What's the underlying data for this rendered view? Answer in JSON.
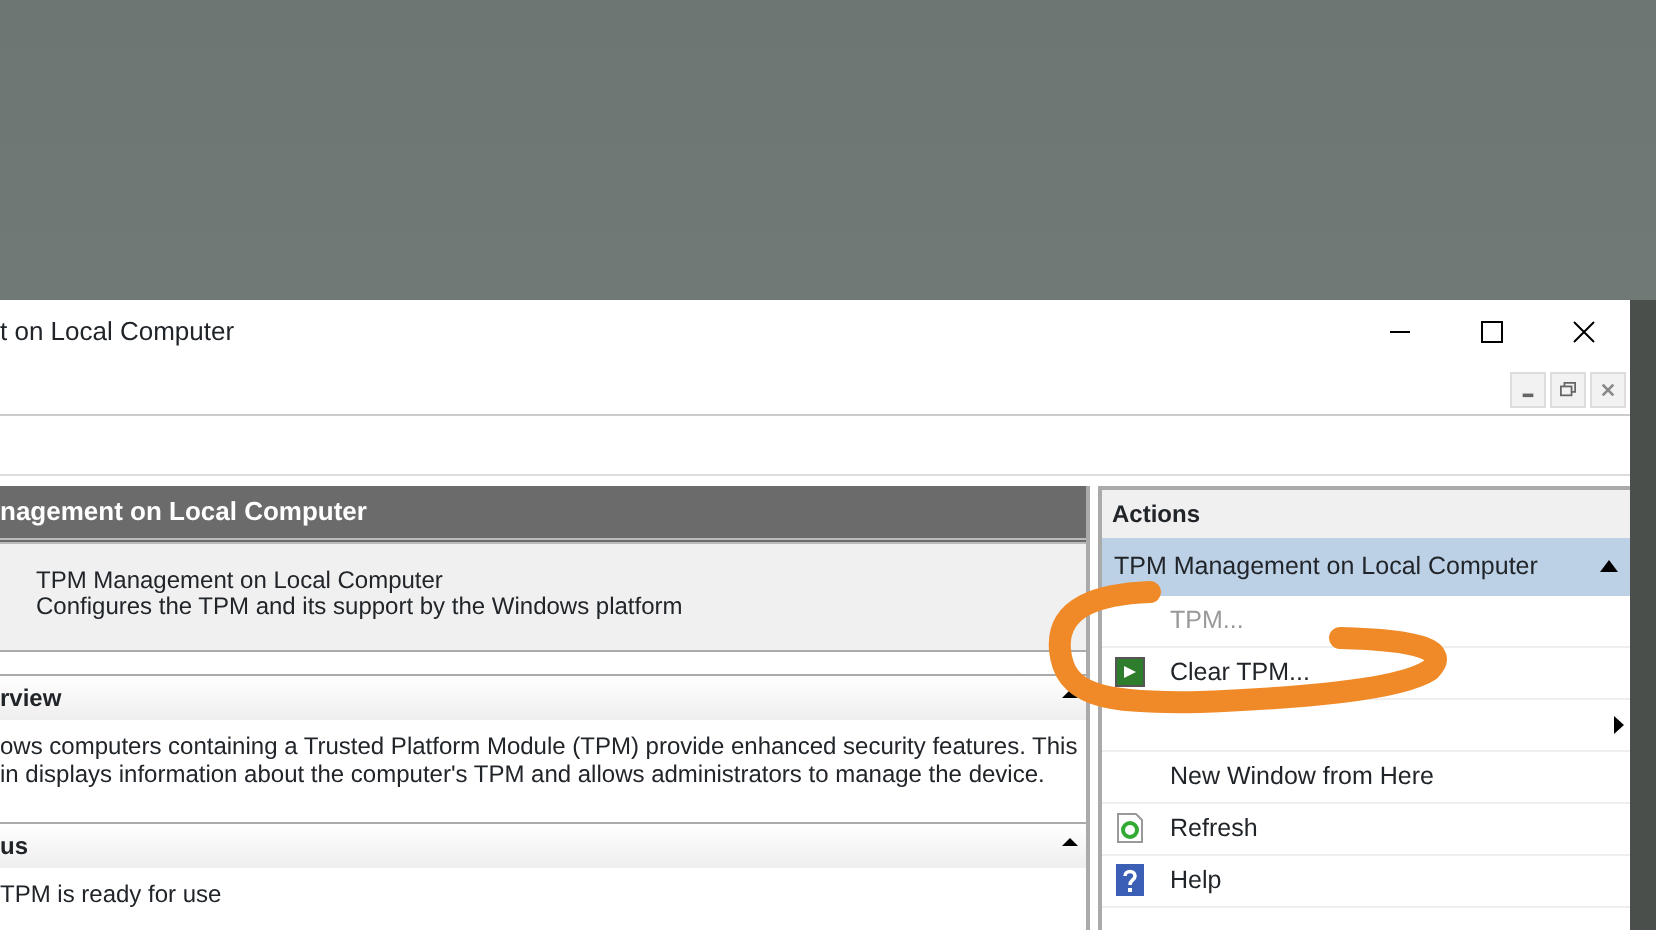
{
  "window": {
    "title": "t on Local Computer"
  },
  "main": {
    "header": "nagement on Local Computer",
    "summary": {
      "title": "TPM Management on Local Computer",
      "description": "Configures the TPM and its support by the Windows platform"
    },
    "sections": [
      {
        "title": "rview",
        "expanded": true,
        "lines": [
          "ows computers containing a Trusted Platform Module (TPM) provide enhanced security features. This",
          "in displays information about the computer's TPM and allows administrators to manage the device."
        ]
      },
      {
        "title": "us",
        "expanded": true,
        "lines": [
          "TPM is ready for use"
        ]
      }
    ]
  },
  "actions": {
    "title": "Actions",
    "group": {
      "label": "TPM Management on Local Computer",
      "expanded": true
    },
    "items": [
      {
        "kind": "plain",
        "label": "TPM...",
        "disabled": true
      },
      {
        "kind": "clear",
        "label": "Clear TPM...",
        "disabled": false
      },
      {
        "kind": "submenu",
        "disabled": false
      },
      {
        "kind": "plain",
        "label": "New Window from Here",
        "disabled": false
      },
      {
        "kind": "refresh",
        "label": "Refresh",
        "disabled": false
      },
      {
        "kind": "help",
        "label": "Help",
        "disabled": false
      }
    ]
  }
}
